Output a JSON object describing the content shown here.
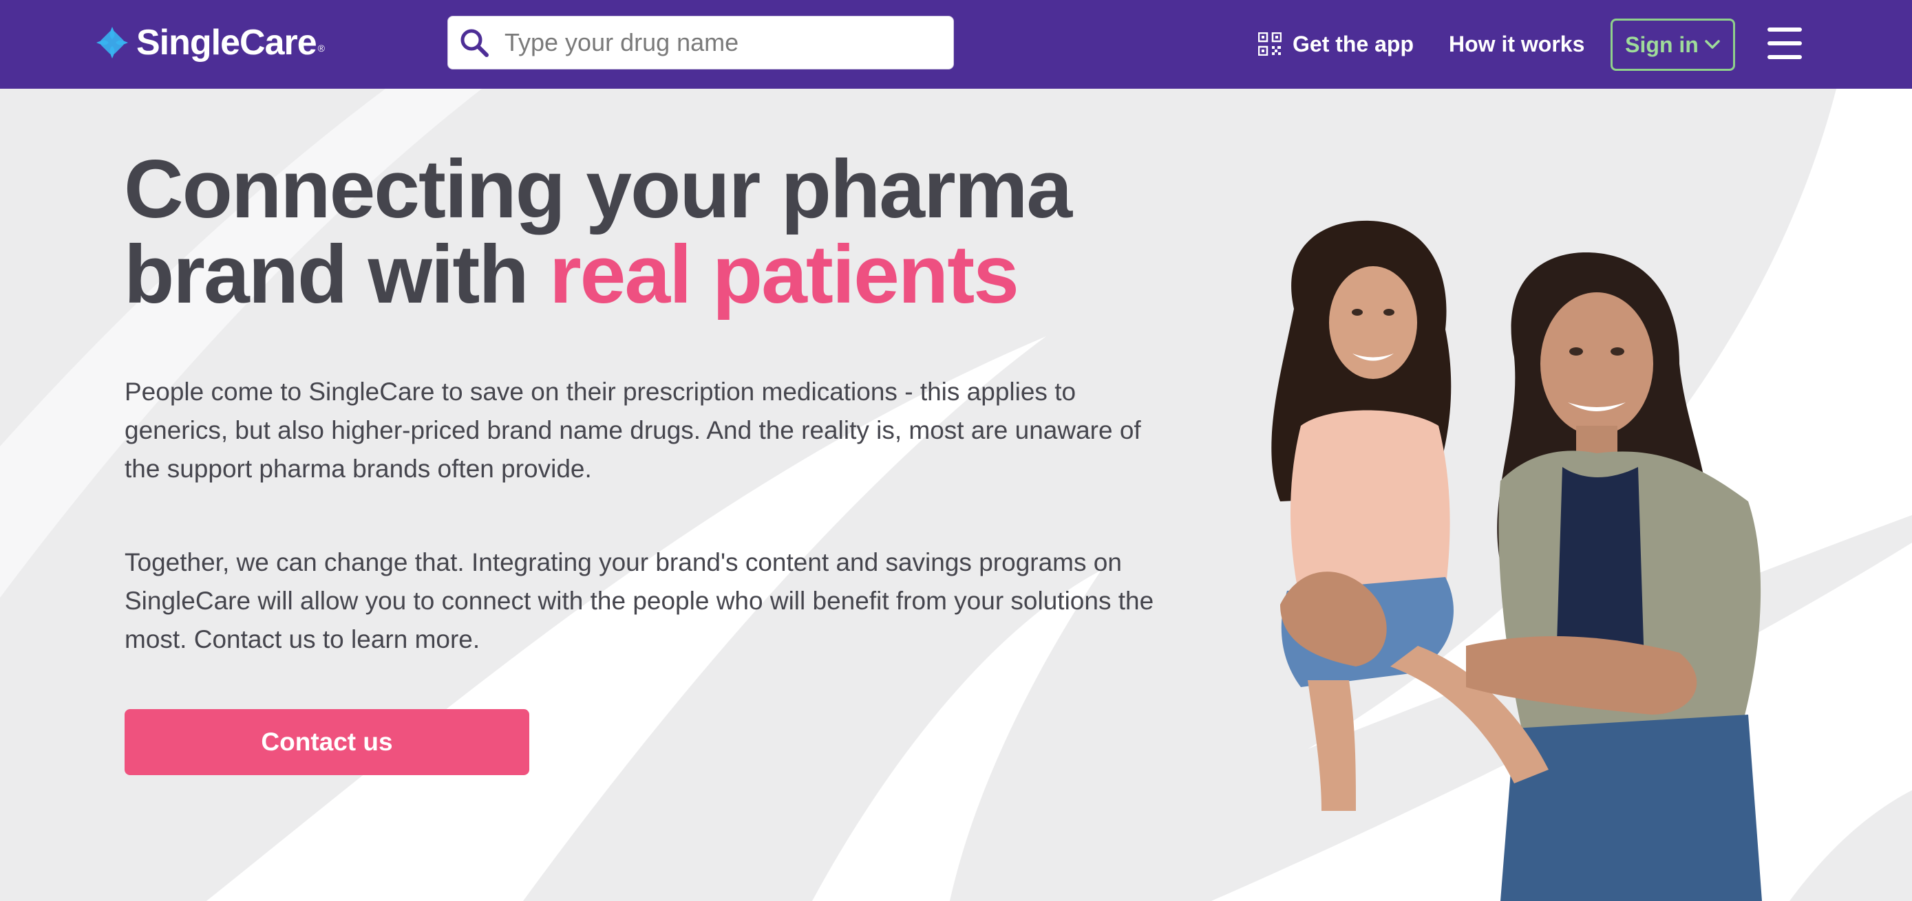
{
  "header": {
    "logo_text": "SingleCare",
    "logo_mark": "®",
    "search_placeholder": "Type your drug name",
    "get_app_label": "Get the app",
    "how_it_works_label": "How it works",
    "sign_in_label": "Sign in"
  },
  "hero": {
    "headline_part1": "Connecting your pharma brand with ",
    "headline_accent": "real patients",
    "paragraph1": "People come to SingleCare to save on their prescription medications - this applies to generics, but also higher-priced brand name drugs. And the reality is, most are unaware of the support pharma brands often provide.",
    "paragraph2": "Together, we can change that. Integrating your brand's content and savings programs on SingleCare will allow you to connect with the people who will benefit from your solutions the most. Contact us to learn more.",
    "cta_label": "Contact us"
  },
  "colors": {
    "header_bg": "#4d2e96",
    "accent_pink": "#ee5081",
    "button_pink": "#ef527e",
    "sign_in_green": "#8fd18b",
    "hero_bg": "#ececed",
    "text_dark": "#45454d",
    "logo_blue": "#38b3f0"
  },
  "icons": {
    "logo": "plus-cross-logo-icon",
    "search": "search-icon",
    "app": "qr-code-icon",
    "sign_in": "chevron-down-icon",
    "menu": "hamburger-menu-icon"
  }
}
